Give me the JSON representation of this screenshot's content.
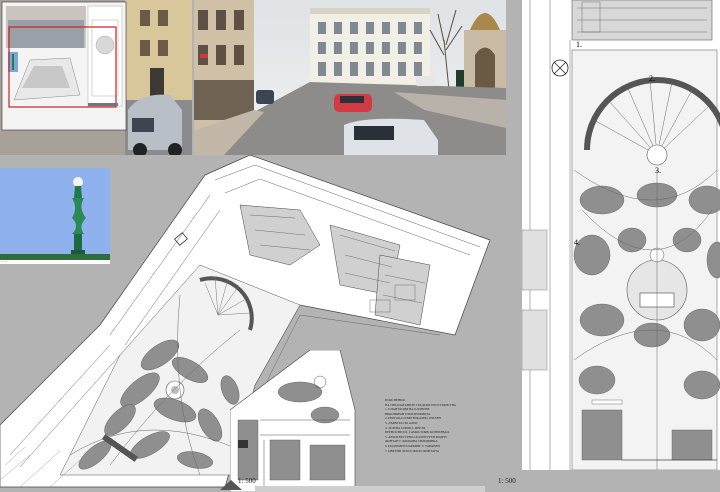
{
  "scale_left": "1: 500",
  "scale_right": "1: 500",
  "plan_numbers": [
    "1.",
    "2.",
    "3.",
    "4."
  ],
  "legend": {
    "lines": [
      "ПОЯСНЕНИЯ",
      "НА ПРЕДЛАГАНИТЕ ГРАДСКИ ПРОСТРАНСТВА",
      "1. ПЛАНТАЦИЯ НА КЛОНОВЕ",
      "ВИКОНИРАН ЕЛЕКТРОФИКТА",
      "2. ПЕРГОЛА И ВЕРТИКАЛНО ОЗЕЛЕН",
      "3. ДЪРВЕТА ПО АЛЕИ",
      "4. ЗЕЛЕНА ПЛОЩ С ЦВЕТЯ",
      "ПРЕНОСНИ ЕЛ. САМОСТОЯВ. КОНЗЕРВАЦ.",
      "5. АРХИТЕКТУРНО-СКУЛПТУРЕН ВОДЕН",
      "ФОНТАН С ФОЛЬОВА ОБЛИЦОВКА",
      "6. ПОДЗЕМЕН ПАРКИНГ С ТАВАНЕН",
      "7. ЦВЕТНИ ЛЕХИ ОКОЛО ФОНТАНА"
    ]
  },
  "colors": {
    "background": "#b3b3b3",
    "plan_paper": "#ffffff",
    "hatch_gray": "#8f8f8f",
    "overview_frame": "#cc1f1f",
    "sky": "#8fb1ee",
    "lamp_post": "#1f7a4a"
  },
  "icons": {
    "north_arrow": "north-arrow-icon",
    "compass": "compass-icon"
  }
}
